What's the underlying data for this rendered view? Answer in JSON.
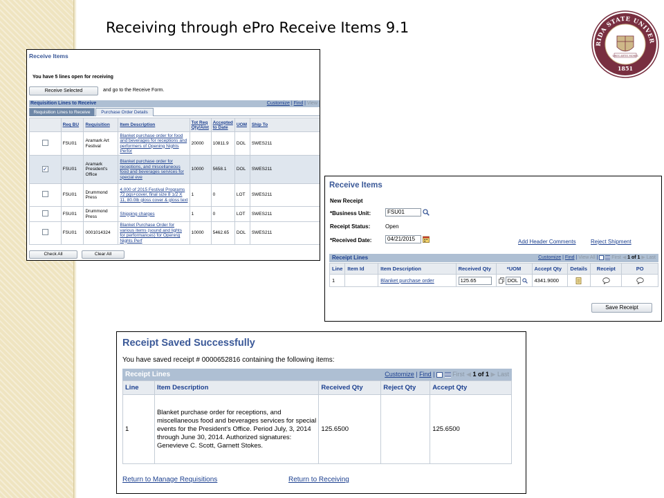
{
  "slide": {
    "title": "Receiving through ePro Receive Items 9.1",
    "seal_text_top": "FLORIDA STATE UNIVERSITY",
    "seal_year": "1851",
    "seal_motto": "VIRES ARTES MORES"
  },
  "screen1": {
    "title": "Receive Items",
    "open_message": "You have 5 lines open for receiving",
    "receive_selected_label": "Receive Selected",
    "receive_after": "and go to the Receive Form.",
    "grid_title": "Requisition Lines to Receive",
    "grid_tools": {
      "customize": "Customize",
      "sep": "|",
      "find": "Find",
      "sep2": "|",
      "view": "View"
    },
    "tabs": [
      "Requisition Lines to Receive",
      "Purchase Order Details"
    ],
    "columns": [
      "Req BU",
      "Requisition",
      "Item Description",
      "Tot Req Qty/Amt",
      "Accepted to Date",
      "UOM",
      "Ship To"
    ],
    "rows": [
      {
        "checked": false,
        "bu": "FSU01",
        "req": "Aramark Art Festival",
        "desc": "Blanket purchase order for food and beverages for receptions and performers of Opening Nights Perfor",
        "qty": "20000",
        "acc": "10811.9",
        "uom": "DOL",
        "ship": "SWES211"
      },
      {
        "checked": true,
        "bu": "FSU01",
        "req": "Aramark President's Office",
        "desc": "Blanket purchase order for receptions, and miscellaneous food and beverages services for special eve",
        "qty": "10000",
        "acc": "5658.1",
        "uom": "DOL",
        "ship": "SWES211"
      },
      {
        "checked": false,
        "bu": "FSU01",
        "req": "Drummond Press",
        "desc": "4,000 of 2015 Festival Programs 72 pgs+cover, final size 8 1/2 X 11, 80.0lb gloss cover & gloss text",
        "qty": "1",
        "acc": "0",
        "uom": "LOT",
        "ship": "SWES211"
      },
      {
        "checked": false,
        "bu": "FSU01",
        "req": "Drummond Press",
        "desc": "Shipping charges",
        "qty": "1",
        "acc": "0",
        "uom": "LOT",
        "ship": "SWES211"
      },
      {
        "checked": false,
        "bu": "FSU01",
        "req": "0001014324",
        "desc": "Blanket Purchase Order for various items (sound and lights for performances) for Opening Nights Perf",
        "qty": "10000",
        "acc": "5462.65",
        "uom": "DOL",
        "ship": "SWES211"
      }
    ],
    "check_mark": "✓",
    "check_all_label": "Check All",
    "clear_all_label": "Clear All"
  },
  "screen2": {
    "title": "Receive Items",
    "new_receipt": "New Receipt",
    "business_unit_label": "*Business Unit:",
    "business_unit_value": "FSU01",
    "status_label": "Receipt Status:",
    "status_value": "Open",
    "date_label": "*Received Date:",
    "date_value": "04/21/2015",
    "add_header_comments": "Add Header Comments",
    "reject_shipment": "Reject Shipment",
    "grid_title": "Receipt Lines",
    "grid_tools": {
      "customize": "Customize",
      "sep": "|",
      "find": "Find",
      "sep2": "|",
      "view_all": "View All",
      "sep3": "|",
      "first": "First",
      "pager": "1 of 1",
      "last": "Last"
    },
    "columns": [
      "Line",
      "Item Id",
      "Item Description",
      "Received Qty",
      "*UOM",
      "Accept Qty",
      "Details",
      "Receipt",
      "PO"
    ],
    "row": {
      "line": "1",
      "item_id": "",
      "desc": "Blanket purchase order",
      "recv_qty": "125.65",
      "uom": "DOL",
      "accept_qty": "4341.9000"
    },
    "save_label": "Save Receipt"
  },
  "screen3": {
    "title": "Receipt Saved Successfully",
    "saved_message": "You have saved receipt # 0000652816 containing the following items:",
    "grid_title": "Receipt Lines",
    "grid_tools": {
      "customize": "Customize",
      "sep": "|",
      "find": "Find",
      "sep2": "|",
      "first": "First",
      "pager": "1 of 1",
      "last": "Last"
    },
    "columns": [
      "Line",
      "Item Description",
      "Received Qty",
      "Reject Qty",
      "Accept Qty"
    ],
    "row": {
      "line": "1",
      "desc": "Blanket purchase order for receptions, and miscellaneous food and beverages services for special events for the President's Office. Period July, 3, 2014 through June 30, 2014. Authorized signatures: Genevieve C. Scott, Garnett Stokes.",
      "recv_qty": "125.6500",
      "reject_qty": "",
      "accept_qty": "125.6500"
    },
    "return_requisitions": "Return to Manage Requisitions",
    "return_receiving": "Return to Receiving"
  },
  "colors": {
    "ps_blue": "#3b5998",
    "link_blue": "#1b3f8f",
    "grid_header": "#aebfd3",
    "seal_maroon": "#782f40",
    "seal_gold": "#ceb888"
  }
}
